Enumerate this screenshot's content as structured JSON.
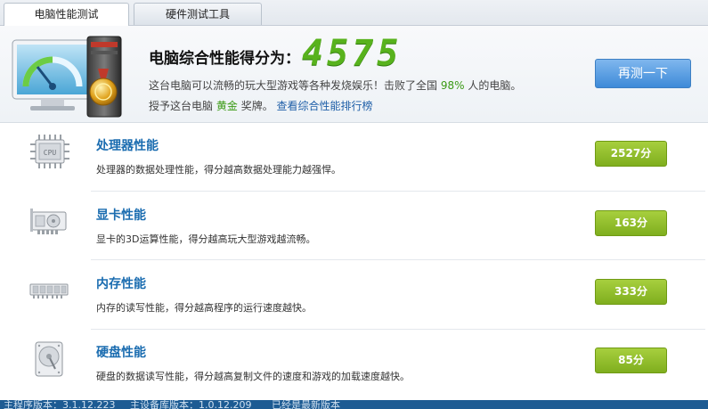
{
  "tabs": [
    {
      "label": "电脑性能测试",
      "active": true
    },
    {
      "label": "硬件测试工具",
      "active": false
    }
  ],
  "header": {
    "score_label": "电脑综合性能得分为：",
    "score_value": "4575",
    "desc_prefix": "这台电脑可以流畅的玩大型游戏等各种发烧娱乐！击败了全国",
    "desc_percent": "98%",
    "desc_suffix": "人的电脑。",
    "award_prefix": "授予这台电脑",
    "award_medal": "黄金",
    "award_suffix": "奖牌。",
    "ranking_link": "查看综合性能排行榜",
    "retest_button": "再测一下"
  },
  "items": [
    {
      "icon": "cpu-icon",
      "title": "处理器性能",
      "desc": "处理器的数据处理性能，得分越高数据处理能力越强悍。",
      "score": "2527分"
    },
    {
      "icon": "graphics-card-icon",
      "title": "显卡性能",
      "desc": "显卡的3D运算性能，得分越高玩大型游戏越流畅。",
      "score": "163分"
    },
    {
      "icon": "memory-module-icon",
      "title": "内存性能",
      "desc": "内存的读写性能，得分越高程序的运行速度越快。",
      "score": "333分"
    },
    {
      "icon": "hard-disk-icon",
      "title": "硬盘性能",
      "desc": "硬盘的数据读写性能，得分越高复制文件的速度和游戏的加载速度越快。",
      "score": "85分"
    }
  ],
  "status": {
    "main_version": "主程序版本：3.1.12.223",
    "db_version": "主设备库版本：1.0.12.209",
    "latest": "已经是最新版本"
  },
  "colors": {
    "score_green": "#58b21d",
    "badge_green": "#8bbb2a",
    "link_blue": "#1f5fa8",
    "button_blue": "#3e8ad8",
    "status_bar": "#1d5b93"
  }
}
